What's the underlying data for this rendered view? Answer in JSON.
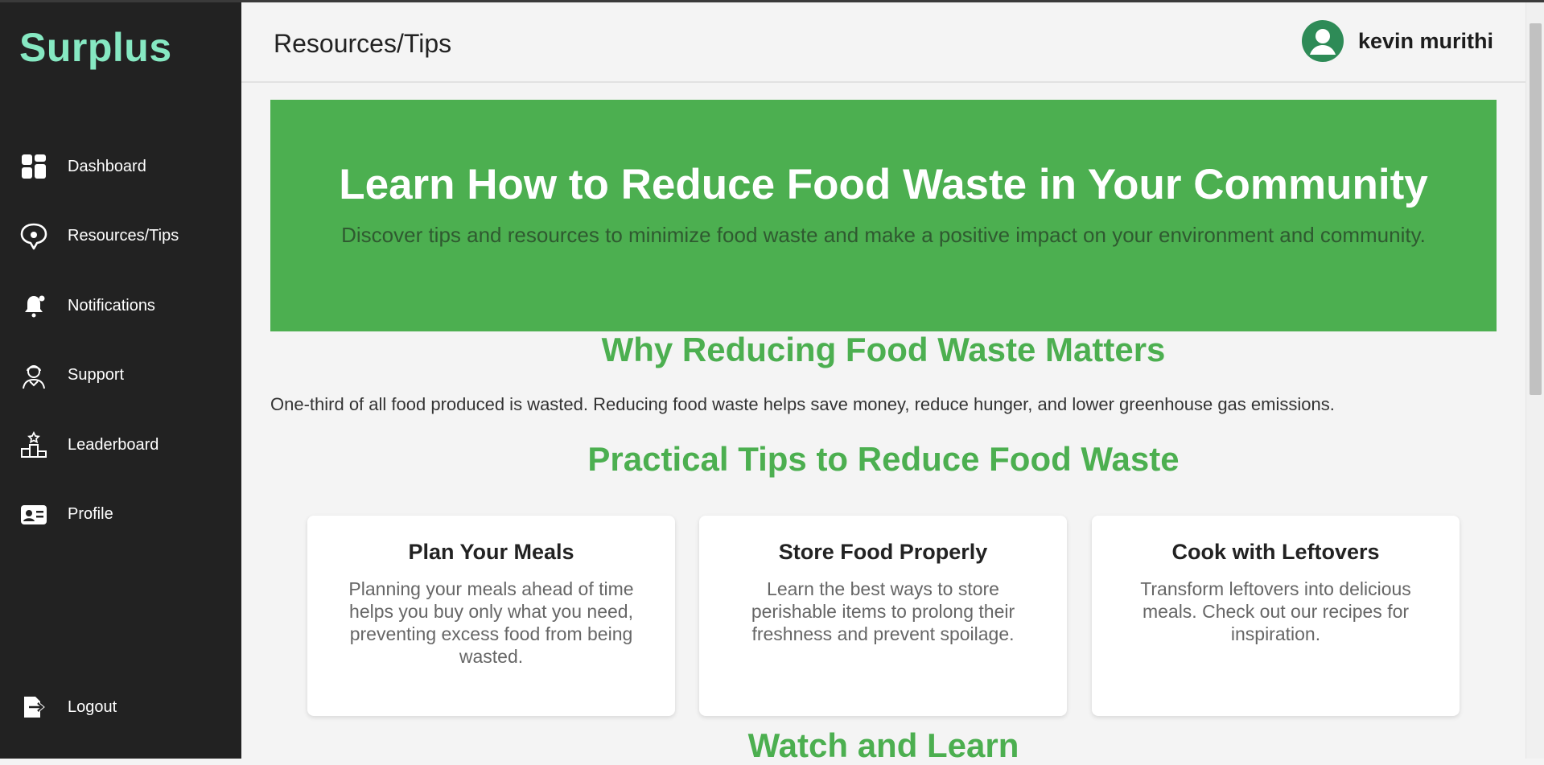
{
  "app": {
    "brand": "Surplus"
  },
  "sidebar": {
    "items": [
      {
        "label": "Dashboard",
        "icon": "dashboard-icon"
      },
      {
        "label": "Resources/Tips",
        "icon": "lightbulb-chat-icon"
      },
      {
        "label": "Notifications",
        "icon": "bell-icon"
      },
      {
        "label": "Support",
        "icon": "support-agent-icon"
      },
      {
        "label": "Leaderboard",
        "icon": "podium-icon"
      },
      {
        "label": "Profile",
        "icon": "id-card-icon"
      }
    ],
    "logout": {
      "label": "Logout",
      "icon": "logout-icon"
    }
  },
  "header": {
    "title": "Resources/Tips",
    "user_name": "kevin murithi",
    "avatar_icon": "user-avatar-icon"
  },
  "hero": {
    "title": "Learn How to Reduce Food Waste in Your Community",
    "subtitle": "Discover tips and resources to minimize food waste and make a positive impact on your environment and community."
  },
  "why": {
    "title": "Why Reducing Food Waste Matters",
    "text": "One-third of all food produced is wasted. Reducing food waste helps save money, reduce hunger, and lower greenhouse gas emissions."
  },
  "tips": {
    "title": "Practical Tips to Reduce Food Waste",
    "cards": [
      {
        "title": "Plan Your Meals",
        "text": "Planning your meals ahead of time helps you buy only what you need, preventing excess food from being wasted."
      },
      {
        "title": "Store Food Properly",
        "text": "Learn the best ways to store perishable items to prolong their freshness and prevent spoilage."
      },
      {
        "title": "Cook with Leftovers",
        "text": "Transform leftovers into delicious meals. Check out our recipes for inspiration."
      }
    ]
  },
  "watch": {
    "title": "Watch and Learn"
  },
  "colors": {
    "sidebar": "#222222",
    "brand": "#86e8c2",
    "accent": "#4caf50",
    "avatar": "#2e8b57"
  }
}
